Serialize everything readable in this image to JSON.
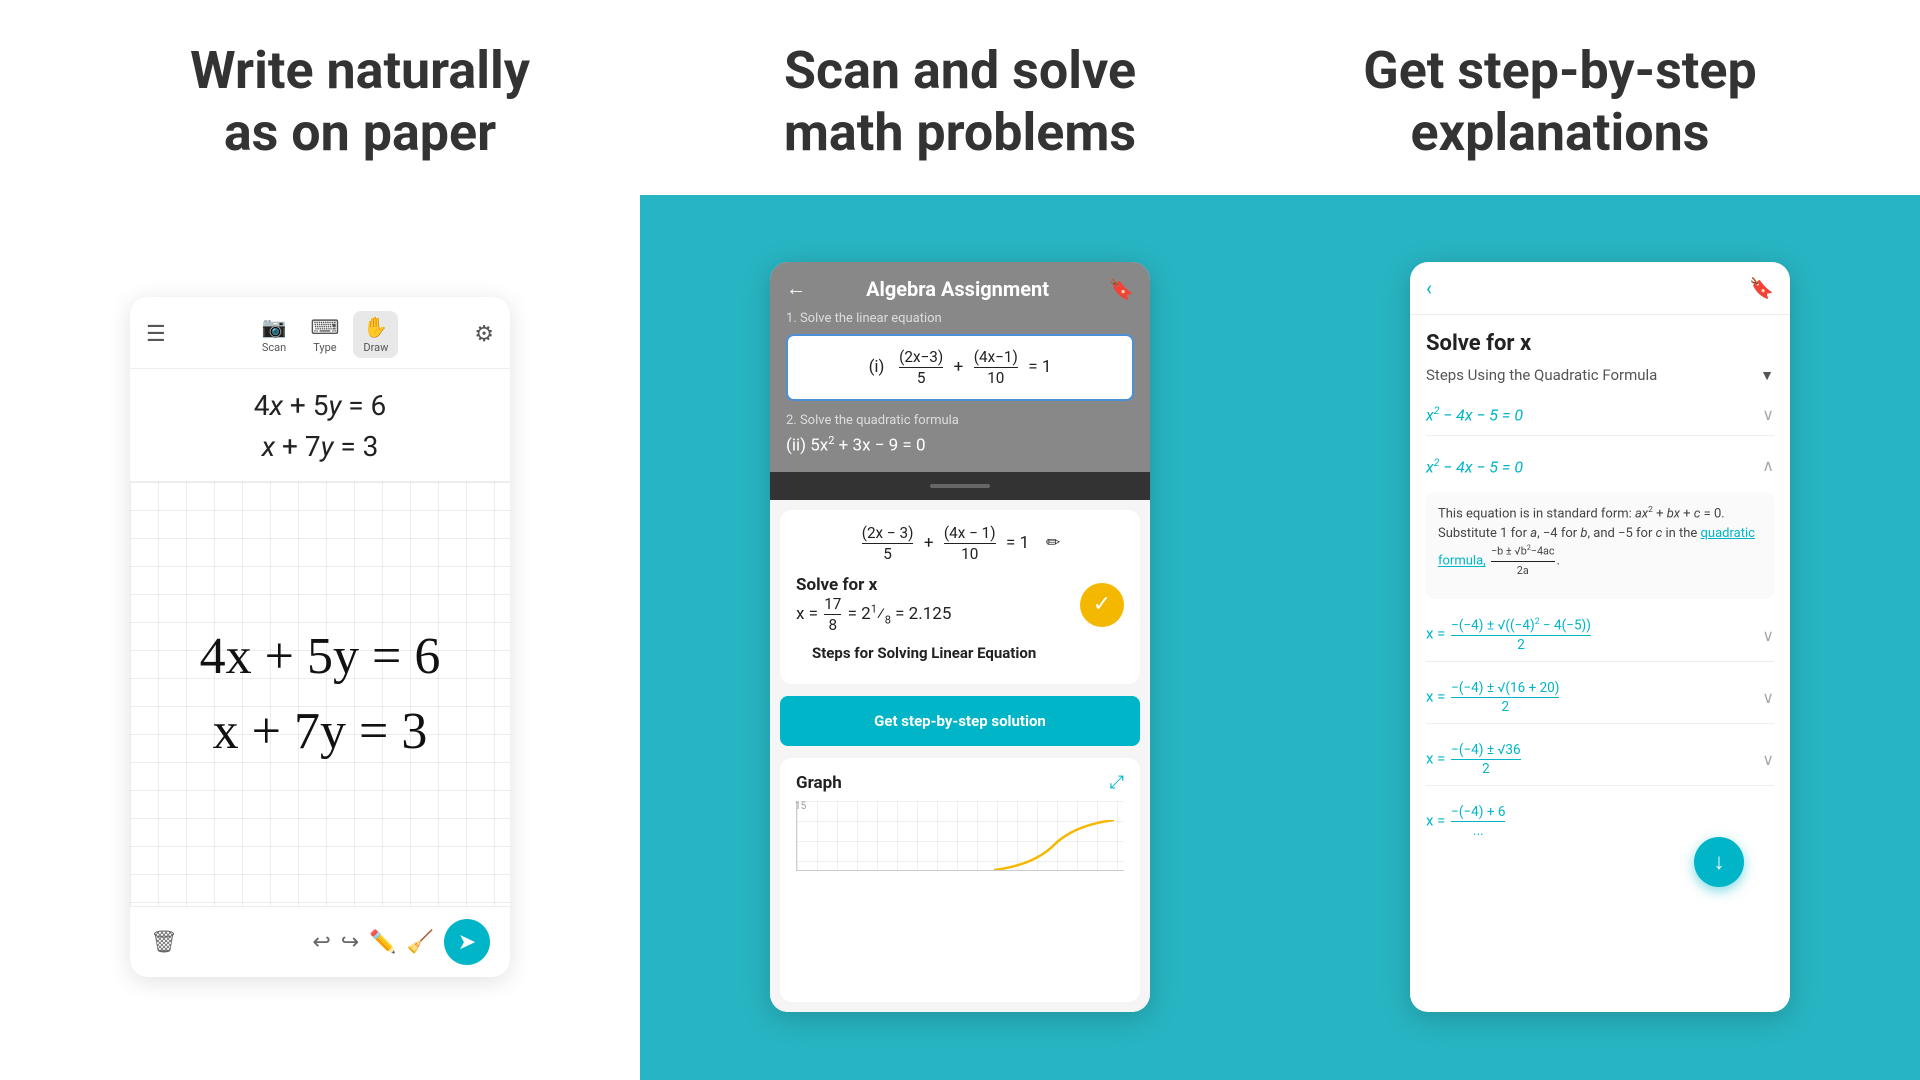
{
  "headers": {
    "col1": "Write naturally\nas on paper",
    "col2": "Scan and solve\nmath problems",
    "col3": "Get step-by-step\nexplanations"
  },
  "left_panel": {
    "toolbar": {
      "scan_label": "Scan",
      "type_label": "Type",
      "draw_label": "Draw"
    },
    "typed_eq1": "4x + 5y = 6",
    "typed_eq2": "x + 7y = 3",
    "handwritten_eq1": "4x + 5y = 6",
    "handwritten_eq2": "x + 7y = 3"
  },
  "mid_panel": {
    "title": "Algebra Assignment",
    "problem1_label": "1. Solve the linear equation",
    "problem1_eq": "(i) (2x−3)/5 + (4x−1)/10 = 1",
    "problem2_label": "2. Solve the quadratic formula",
    "problem2_eq": "(ii) 5x² + 3x − 9 = 0",
    "result_eq": "(2x − 3)/5 + (4x − 1)/10 = 1",
    "solve_label": "Solve for x",
    "solve_value": "x = 17/8 = 2⅛ = 2.125",
    "steps_label": "Steps for Solving Linear Equation",
    "cta_label": "Get step-by-step solution",
    "graph_title": "Graph",
    "graph_label_15": "15"
  },
  "right_panel": {
    "solve_title": "Solve for x",
    "method_label": "Steps Using the Quadratic Formula",
    "step1_eq": "x² − 4x − 5 = 0",
    "step2_eq": "x² − 4x − 5 = 0",
    "expanded_text": "This equation is in standard form: ax² + bx + c = 0. Substitute 1 for a, −4 for b, and −5 for c in the",
    "quadratic_formula_link": "quadratic formula,",
    "formula_suffix": "−b ± √(b²−4ac) / 2a",
    "step3_eq": "x = (−(−4) ± √((−4)² − 4(−5))) / 2",
    "step4_eq": "x = (−(−4) ± √(16 + 20)) / 2",
    "step5_eq": "x = (−(−4) ± √36) / 2",
    "step6_eq": "x = (−(−4) + 6) / ...",
    "down_arrow": "↓"
  },
  "colors": {
    "teal": "#28b5c3",
    "accent": "#00b5c8",
    "yellow": "#f5b800",
    "text_dark": "#222222",
    "text_mid": "#555555"
  }
}
